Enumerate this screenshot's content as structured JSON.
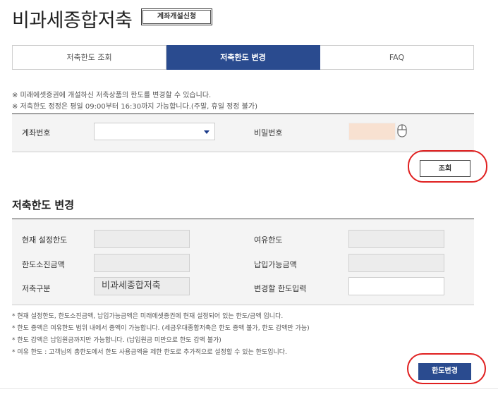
{
  "header": {
    "title": "비과세종합저축",
    "open_account_btn": "계좌개설신청"
  },
  "tabs": [
    {
      "label": "저축한도 조회",
      "active": false
    },
    {
      "label": "저축한도 변경",
      "active": true
    },
    {
      "label": "FAQ",
      "active": false
    }
  ],
  "notes": [
    "※ 미래에셋증권에 개설하신 저축상품의 한도를 변경할 수 있습니다.",
    "※ 저축한도 정정은 평일 09:00부터 16:30까지 가능합니다.(주말, 휴일 정정 불가)"
  ],
  "query_form": {
    "account_label": "계좌번호",
    "account_value": "",
    "password_label": "비밀번호",
    "query_btn": "조회"
  },
  "change_section": {
    "title": "저축한도 변경",
    "current_limit_label": "현재 설정한도",
    "current_limit_value": "",
    "spare_limit_label": "여유한도",
    "spare_limit_value": "",
    "used_amount_label": "한도소진금액",
    "used_amount_value": "",
    "payable_amount_label": "납입가능금액",
    "payable_amount_value": "",
    "savings_type_label": "저축구분",
    "savings_type_value": "비과세종합저축",
    "new_limit_label": "변경할 한도입력",
    "new_limit_value": ""
  },
  "footnotes": [
    "* 현재 설정한도, 한도소진금액, 납입가능금액은 미래에셋증권에 현재 설정되어 있는 한도/금액 입니다.",
    "* 한도 증액은 여유한도 범위 내에서 증액이 가능합니다. (세금우대종합저축은 한도 증액 불가, 한도 감액만 가능)",
    "* 한도 감액은 납입원금까지만 가능합니다. (납입원금 미만으로 한도 감액 불가)",
    "* 여유 한도 : 고객님의 총한도에서 한도 사용금액을 제한 한도로 추가적으로 설정할 수 있는 한도입니다."
  ],
  "change_btn": "한도변경",
  "colors": {
    "accent": "#2a4b8f",
    "highlight": "#e02020",
    "password_bg": "#f8e1d1"
  }
}
